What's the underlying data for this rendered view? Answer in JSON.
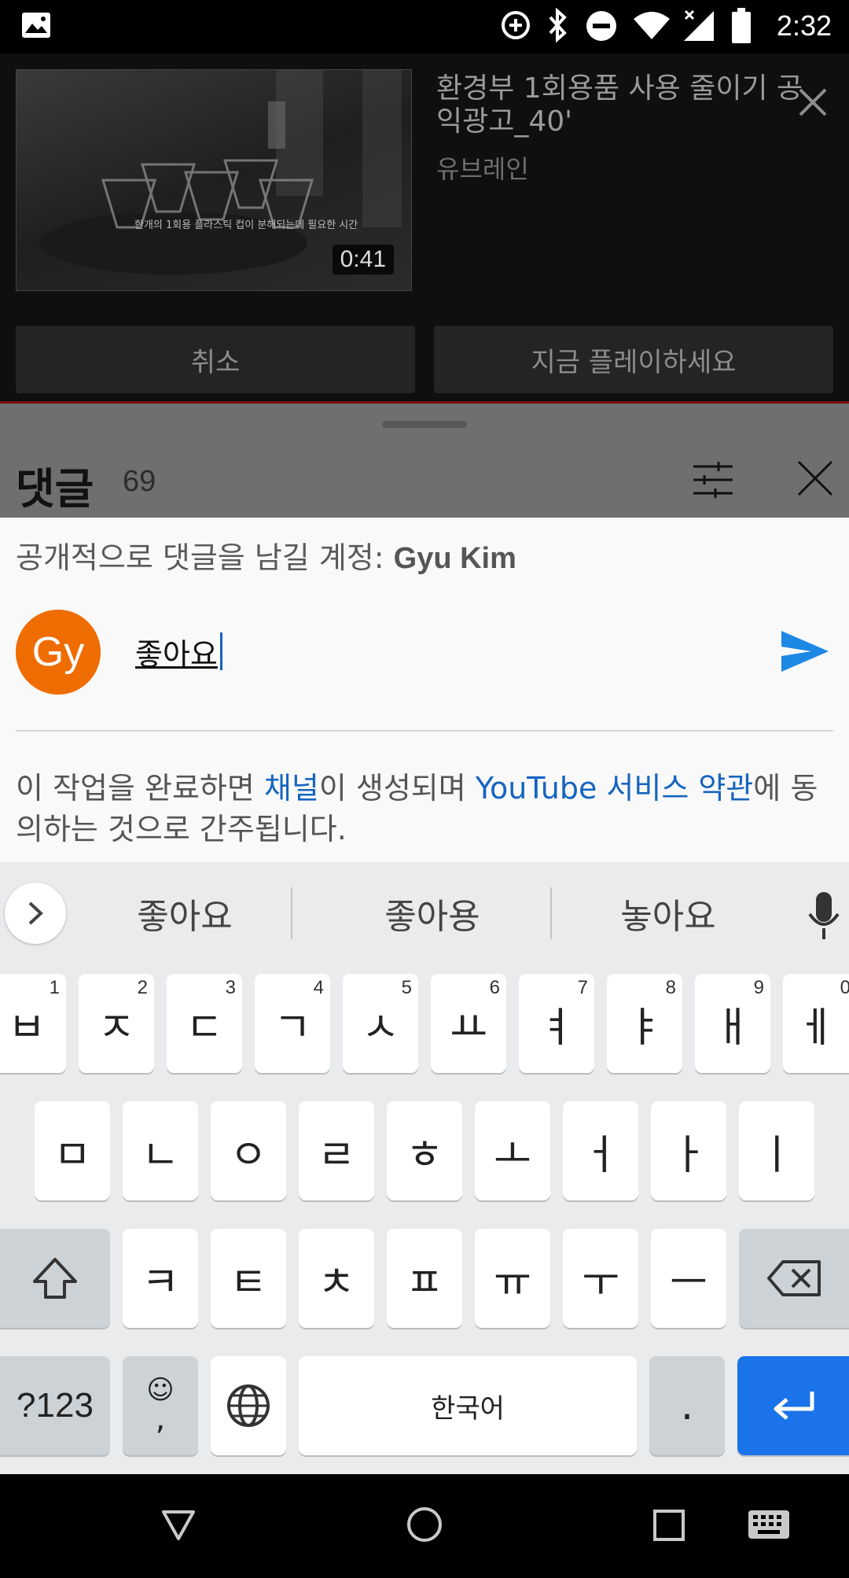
{
  "status_bar": {
    "time": "2:32"
  },
  "video": {
    "title": "환경부 1회용품 사용 줄이기 공익광고_40'",
    "channel": "유브레인",
    "duration": "0:41",
    "caption": "한개의 1회용 플라스틱 컵이 분해되는데 필요한 시간"
  },
  "actions": {
    "cancel": "취소",
    "play_now": "지금 플레이하세요"
  },
  "comments": {
    "title": "댓글",
    "count": "69"
  },
  "compose": {
    "account_prefix": "공개적으로 댓글을 남길 계정: ",
    "account_name": "Gyu Kim",
    "avatar_initials": "Gy",
    "input_value": "좋아요",
    "terms": {
      "p1": "이 작업을 완료하면 ",
      "link1": "채널",
      "p2": "이 생성되며 ",
      "link2": "YouTube 서비스 약관",
      "p3": "에 동의하는 것으로 간주됩니다."
    }
  },
  "keyboard": {
    "suggestions": [
      "좋아요",
      "좋아용",
      "놓아요"
    ],
    "row1": [
      {
        "k": "ㅂ",
        "h": "1"
      },
      {
        "k": "ㅈ",
        "h": "2"
      },
      {
        "k": "ㄷ",
        "h": "3"
      },
      {
        "k": "ㄱ",
        "h": "4"
      },
      {
        "k": "ㅅ",
        "h": "5"
      },
      {
        "k": "ㅛ",
        "h": "6"
      },
      {
        "k": "ㅕ",
        "h": "7"
      },
      {
        "k": "ㅑ",
        "h": "8"
      },
      {
        "k": "ㅐ",
        "h": "9"
      },
      {
        "k": "ㅔ",
        "h": "0"
      }
    ],
    "row2": [
      "ㅁ",
      "ㄴ",
      "ㅇ",
      "ㄹ",
      "ㅎ",
      "ㅗ",
      "ㅓ",
      "ㅏ",
      "ㅣ"
    ],
    "row3": [
      "ㅋ",
      "ㅌ",
      "ㅊ",
      "ㅍ",
      "ㅠ",
      "ㅜ",
      "ㅡ"
    ],
    "symbols": "?123",
    "emoji": "☺",
    "comma": ",",
    "space": "한국어",
    "period": "."
  },
  "colors": {
    "accent_blue": "#1565c0",
    "avatar_orange": "#ef6c00",
    "enter_blue": "#1a73e8"
  }
}
